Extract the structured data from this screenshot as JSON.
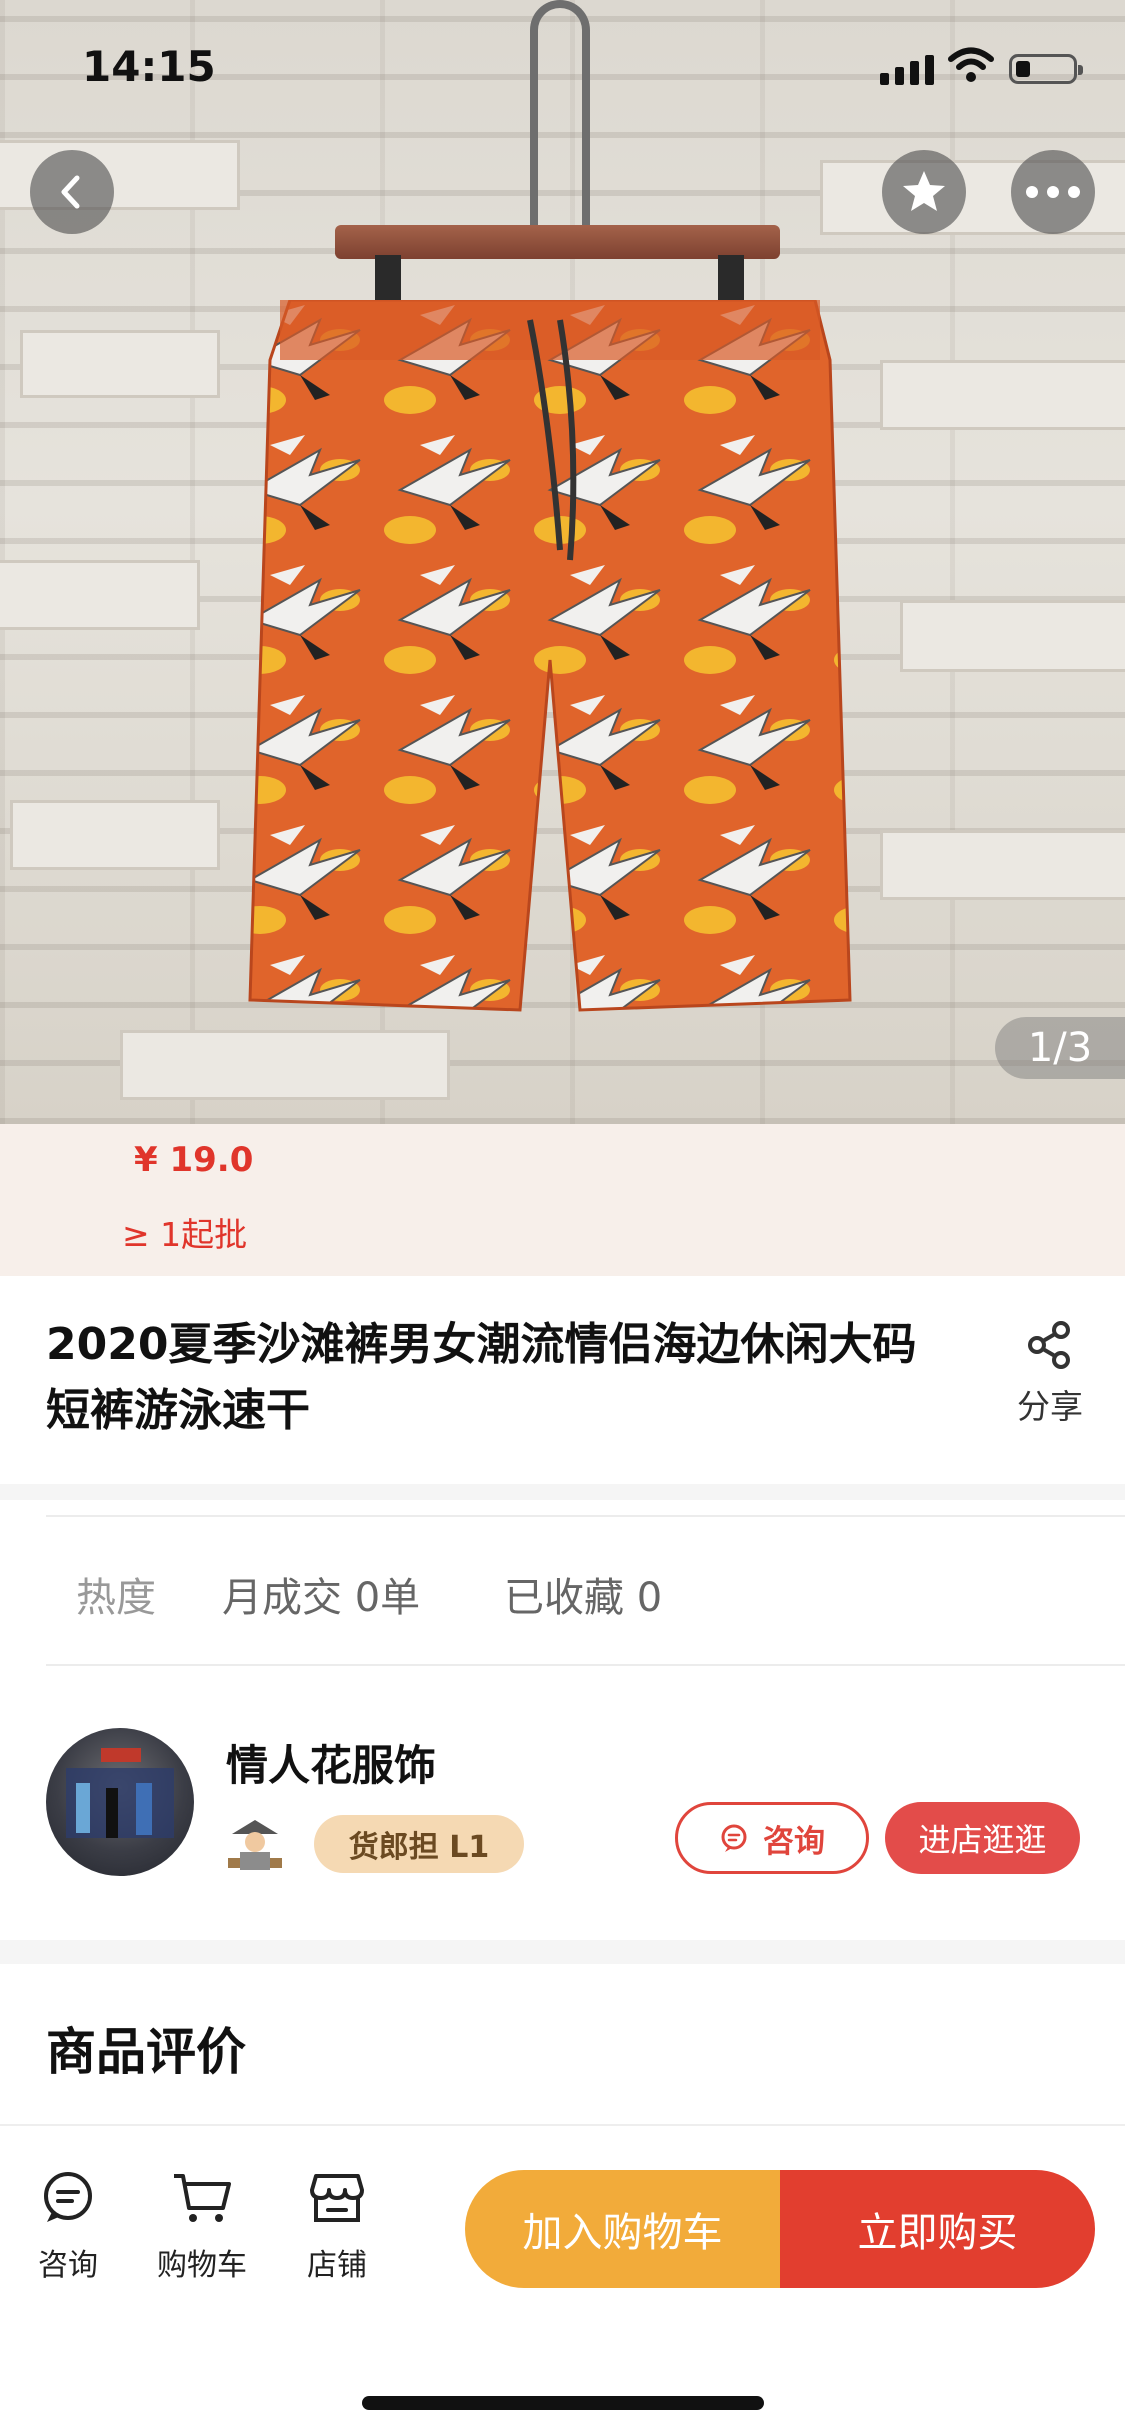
{
  "status_bar": {
    "time": "14:15"
  },
  "gallery": {
    "counter": "1/3"
  },
  "colors": {
    "accent": "#e0352b",
    "cart_button": "#f2ab3a",
    "buy_button": "#e23e2f",
    "badge": "#f5d9b3"
  },
  "price": {
    "amount": "¥ 19.0",
    "moq": "≥ 1起批"
  },
  "product": {
    "title": "2020夏季沙滩裤男女潮流情侣海边休闲大码短裤游泳速干",
    "share_label": "分享"
  },
  "stats": {
    "heat": "热度",
    "monthly_sales": "月成交 0单",
    "favorites": "已收藏 0"
  },
  "shop": {
    "name": "情人花服饰",
    "level": "货郎担 L1",
    "consult_label": "咨询",
    "enter_label": "进店逛逛"
  },
  "reviews": {
    "title": "商品评价"
  },
  "bottom_bar": {
    "tabs": [
      {
        "label": "咨询",
        "icon": "chat-icon"
      },
      {
        "label": "购物车",
        "icon": "cart-icon"
      },
      {
        "label": "店铺",
        "icon": "store-icon"
      }
    ],
    "add_to_cart": "加入购物车",
    "buy_now": "立即购买"
  }
}
